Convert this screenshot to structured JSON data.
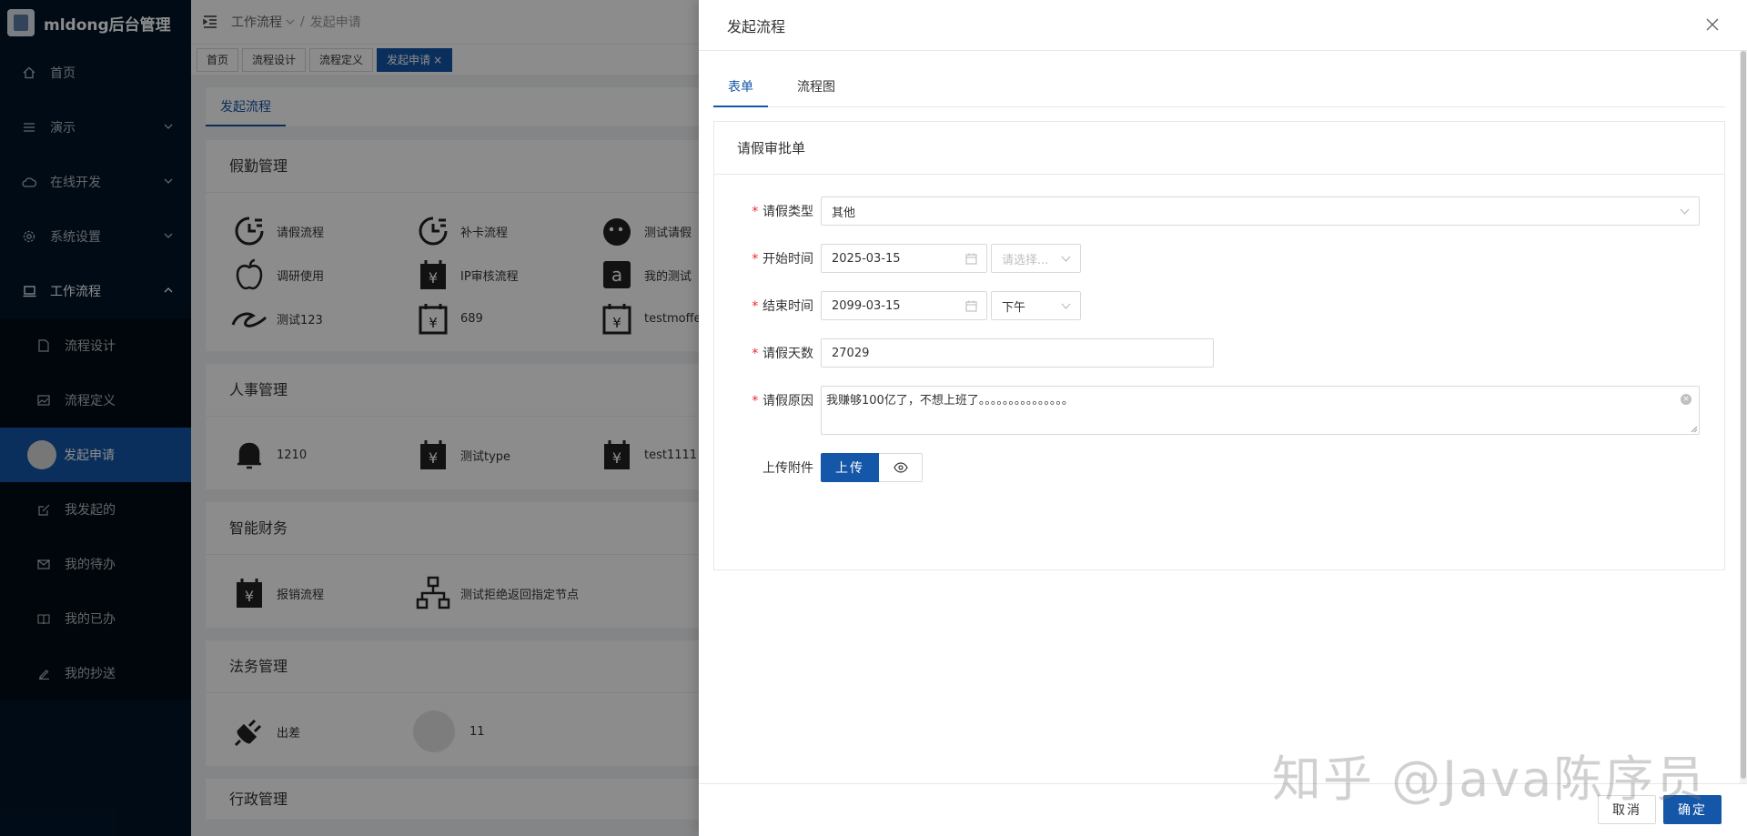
{
  "app": {
    "title": "mldong后台管理"
  },
  "sidebar": {
    "items": [
      {
        "label": "首页",
        "icon": "home-icon"
      },
      {
        "label": "演示",
        "icon": "list-icon"
      },
      {
        "label": "在线开发",
        "icon": "cloud-icon"
      },
      {
        "label": "系统设置",
        "icon": "gear-icon"
      },
      {
        "label": "工作流程",
        "icon": "laptop-icon"
      }
    ],
    "workflow_children": [
      {
        "label": "流程设计",
        "icon": "file-icon"
      },
      {
        "label": "流程定义",
        "icon": "image-icon"
      },
      {
        "label": "发起申请",
        "icon": "avatar"
      },
      {
        "label": "我发起的",
        "icon": "edit-icon"
      },
      {
        "label": "我的待办",
        "icon": "mail-icon"
      },
      {
        "label": "我的已办",
        "icon": "book-icon"
      },
      {
        "label": "我的抄送",
        "icon": "pen-icon"
      }
    ]
  },
  "header": {
    "breadcrumb": [
      "工作流程",
      "发起申请"
    ]
  },
  "tags": [
    {
      "label": "首页"
    },
    {
      "label": "流程设计"
    },
    {
      "label": "流程定义"
    },
    {
      "label": "发起申请",
      "close": "×"
    }
  ],
  "content": {
    "tab": "发起流程",
    "sections": [
      {
        "title": "假勤管理",
        "items": [
          {
            "label": "请假流程",
            "icon": "clock-icon"
          },
          {
            "label": "补卡流程",
            "icon": "clock-icon"
          },
          {
            "label": "测试请假",
            "icon": "face-icon"
          },
          {
            "label": "调研使用",
            "icon": "apple-icon"
          },
          {
            "label": "IP审核流程",
            "icon": "yen-calendar-icon"
          },
          {
            "label": "我的测试",
            "icon": "amazon-icon"
          },
          {
            "label": "测试123",
            "icon": "alibaba-icon"
          },
          {
            "label": "689",
            "icon": "yen-calendar-outline-icon"
          },
          {
            "label": "testmoffe",
            "icon": "yen-calendar-outline-icon"
          }
        ]
      },
      {
        "title": "人事管理",
        "items": [
          {
            "label": "1210",
            "icon": "bell-icon"
          },
          {
            "label": "测试type",
            "icon": "yen-calendar-icon"
          },
          {
            "label": "test1111",
            "icon": "yen-calendar-icon"
          }
        ]
      },
      {
        "title": "智能财务",
        "items": [
          {
            "label": "报销流程",
            "icon": "yen-calendar-icon"
          },
          {
            "label": "测试拒绝返回指定节点",
            "icon": "org-chart-icon"
          }
        ]
      },
      {
        "title": "法务管理",
        "items": [
          {
            "label": "出差",
            "icon": "plug-icon"
          },
          {
            "label": "11",
            "icon": "empty-circle"
          }
        ]
      },
      {
        "title": "行政管理",
        "items": []
      }
    ]
  },
  "drawer": {
    "title": "发起流程",
    "tabs": [
      "表单",
      "流程图"
    ],
    "card_title": "请假审批单",
    "form": {
      "leave_type": {
        "label": "请假类型",
        "value": "其他"
      },
      "start_time": {
        "label": "开始时间",
        "date": "2025-03-15",
        "period_placeholder": "请选择..."
      },
      "end_time": {
        "label": "结束时间",
        "date": "2099-03-15",
        "period": "下午"
      },
      "days": {
        "label": "请假天数",
        "value": "27029"
      },
      "reason": {
        "label": "请假原因",
        "value": "我赚够100亿了，不想上班了。。。。。。。。。。。。。。。"
      },
      "attachment": {
        "label": "上传附件",
        "upload_label": "上传"
      }
    },
    "footer": {
      "cancel": "取消",
      "ok": "确定"
    }
  },
  "watermark": "知乎 @Java陈序员",
  "colors": {
    "primary": "#1456a8",
    "sidebar": "#001529",
    "required": "#f5222d"
  }
}
